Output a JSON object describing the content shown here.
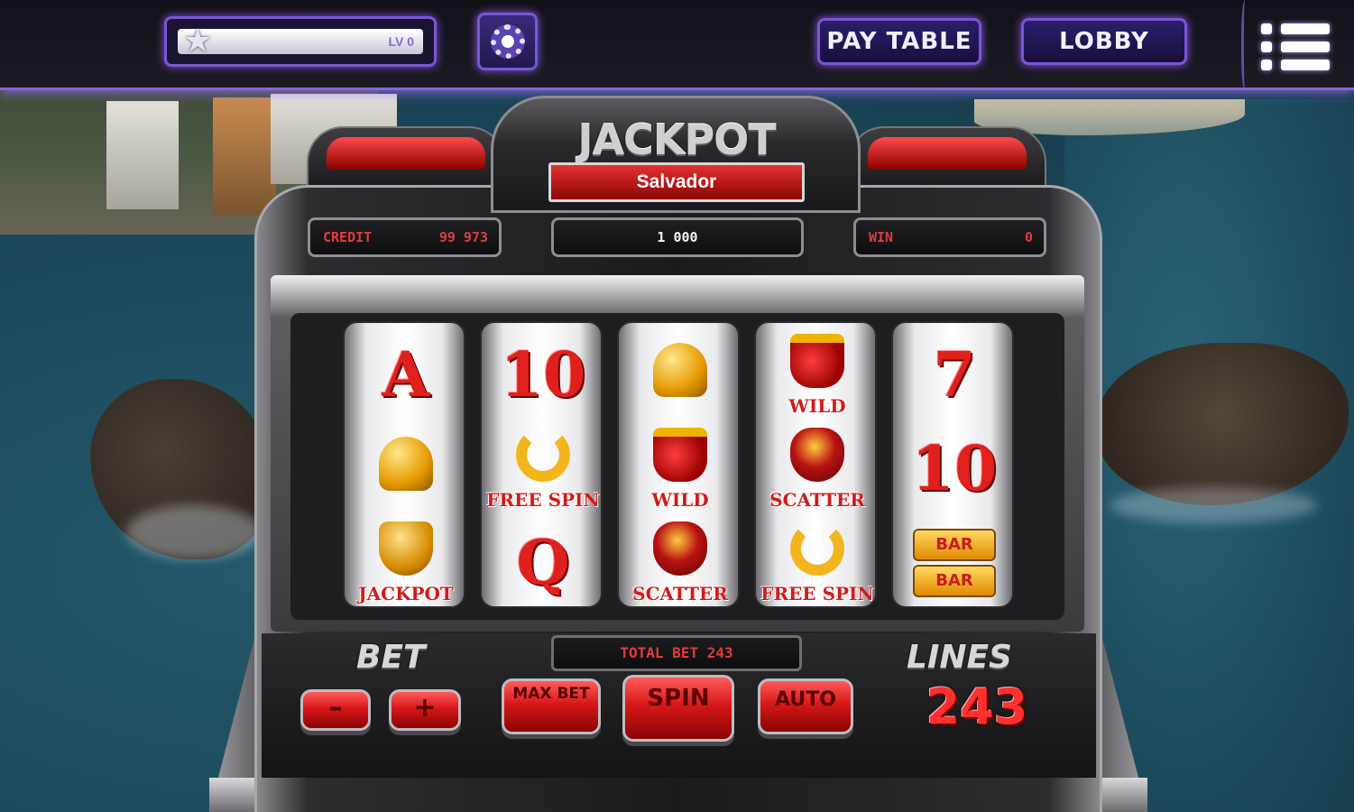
{
  "top_bar": {
    "level_text": "LV 0",
    "level_progress": 0.0,
    "pay_table_label": "PAY TABLE",
    "lobby_label": "LOBBY"
  },
  "jackpot": {
    "title": "JACKPOT",
    "location": "Salvador"
  },
  "counters": {
    "credit_label": "CREDIT",
    "credit_value": "99 973",
    "bet_value": "1 000",
    "win_label": "WIN",
    "win_value": "0"
  },
  "reels": [
    [
      {
        "symbol": "A",
        "kind": "letter"
      },
      {
        "symbol": "bell",
        "kind": "icon"
      },
      {
        "symbol": "JACKPOT",
        "kind": "labeled",
        "icon": "cup"
      }
    ],
    [
      {
        "symbol": "10",
        "kind": "letter"
      },
      {
        "symbol": "FREE SPIN",
        "kind": "labeled",
        "icon": "horseshoe"
      },
      {
        "symbol": "Q",
        "kind": "letter"
      }
    ],
    [
      {
        "symbol": "bell",
        "kind": "icon"
      },
      {
        "symbol": "WILD",
        "kind": "labeled",
        "icon": "crown"
      },
      {
        "symbol": "SCATTER",
        "kind": "labeled",
        "icon": "sack"
      }
    ],
    [
      {
        "symbol": "WILD",
        "kind": "labeled",
        "icon": "crown"
      },
      {
        "symbol": "SCATTER",
        "kind": "labeled",
        "icon": "sack"
      },
      {
        "symbol": "FREE SPIN",
        "kind": "labeled",
        "icon": "horseshoe"
      }
    ],
    [
      {
        "symbol": "7",
        "kind": "letter"
      },
      {
        "symbol": "10",
        "kind": "letter"
      },
      {
        "symbol": "BAR",
        "kind": "bar"
      }
    ]
  ],
  "controls": {
    "bet_label": "BET",
    "minus_label": "–",
    "plus_label": "+",
    "max_bet_label": "MAX BET",
    "spin_label": "SPIN",
    "auto_label": "AUTO",
    "total_bet": "TOTAL BET 243",
    "lines_label": "LINES",
    "lines_value": "243"
  },
  "colors": {
    "accent_purple": "#7b55d6",
    "red_button": "#d61818",
    "counter_text": "#e23b3b"
  }
}
